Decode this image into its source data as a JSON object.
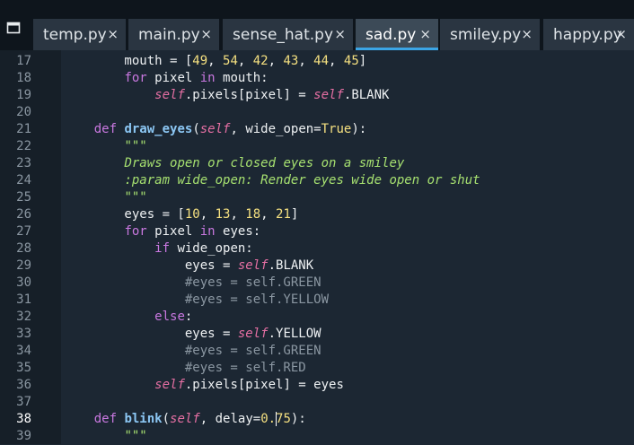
{
  "tabs": [
    {
      "label": "temp.py",
      "active": false
    },
    {
      "label": "main.py",
      "active": false
    },
    {
      "label": "sense_hat.py",
      "active": false
    },
    {
      "label": "sad.py",
      "active": true
    },
    {
      "label": "smiley.py",
      "active": false
    },
    {
      "label": "happy.py",
      "active": false
    }
  ],
  "tab_close_glyph": "×",
  "tabs_menu_icon": "tabs-menu-icon",
  "editor": {
    "current_line": 38,
    "lines": [
      {
        "n": "17",
        "tokens": [
          [
            "txt",
            "        mouth = ["
          ],
          [
            "num",
            "49"
          ],
          [
            "txt",
            ", "
          ],
          [
            "num",
            "54"
          ],
          [
            "txt",
            ", "
          ],
          [
            "num",
            "42"
          ],
          [
            "txt",
            ", "
          ],
          [
            "num",
            "43"
          ],
          [
            "txt",
            ", "
          ],
          [
            "num",
            "44"
          ],
          [
            "txt",
            ", "
          ],
          [
            "num",
            "45"
          ],
          [
            "txt",
            "]"
          ]
        ]
      },
      {
        "n": "18",
        "tokens": [
          [
            "txt",
            "        "
          ],
          [
            "kw",
            "for"
          ],
          [
            "txt",
            " pixel "
          ],
          [
            "kw",
            "in"
          ],
          [
            "txt",
            " mouth:"
          ]
        ]
      },
      {
        "n": "19",
        "tokens": [
          [
            "txt",
            "            "
          ],
          [
            "self",
            "self"
          ],
          [
            "txt",
            ".pixels[pixel] = "
          ],
          [
            "self",
            "self"
          ],
          [
            "txt",
            ".BLANK"
          ]
        ]
      },
      {
        "n": "20",
        "tokens": []
      },
      {
        "n": "21",
        "tokens": [
          [
            "txt",
            "    "
          ],
          [
            "kw",
            "def"
          ],
          [
            "txt",
            " "
          ],
          [
            "fn",
            "draw_eyes"
          ],
          [
            "txt",
            "("
          ],
          [
            "self",
            "self"
          ],
          [
            "txt",
            ", wide_open="
          ],
          [
            "num",
            "True"
          ],
          [
            "txt",
            "):"
          ]
        ]
      },
      {
        "n": "22",
        "tokens": [
          [
            "txt",
            "        "
          ],
          [
            "str",
            "\"\"\""
          ]
        ]
      },
      {
        "n": "23",
        "tokens": [
          [
            "txt",
            "        "
          ],
          [
            "str",
            "Draws open or closed eyes on a smiley"
          ]
        ]
      },
      {
        "n": "24",
        "tokens": [
          [
            "txt",
            "        "
          ],
          [
            "str",
            ":param wide_open: Render eyes wide open or shut"
          ]
        ]
      },
      {
        "n": "25",
        "tokens": [
          [
            "txt",
            "        "
          ],
          [
            "str",
            "\"\"\""
          ]
        ]
      },
      {
        "n": "26",
        "tokens": [
          [
            "txt",
            "        eyes = ["
          ],
          [
            "num",
            "10"
          ],
          [
            "txt",
            ", "
          ],
          [
            "num",
            "13"
          ],
          [
            "txt",
            ", "
          ],
          [
            "num",
            "18"
          ],
          [
            "txt",
            ", "
          ],
          [
            "num",
            "21"
          ],
          [
            "txt",
            "]"
          ]
        ]
      },
      {
        "n": "27",
        "tokens": [
          [
            "txt",
            "        "
          ],
          [
            "kw",
            "for"
          ],
          [
            "txt",
            " pixel "
          ],
          [
            "kw",
            "in"
          ],
          [
            "txt",
            " eyes:"
          ]
        ]
      },
      {
        "n": "28",
        "tokens": [
          [
            "txt",
            "            "
          ],
          [
            "kw",
            "if"
          ],
          [
            "txt",
            " wide_open:"
          ]
        ]
      },
      {
        "n": "29",
        "tokens": [
          [
            "txt",
            "                eyes = "
          ],
          [
            "self",
            "self"
          ],
          [
            "txt",
            ".BLANK"
          ]
        ]
      },
      {
        "n": "30",
        "tokens": [
          [
            "txt",
            "                "
          ],
          [
            "cmt",
            "#eyes = self.GREEN"
          ]
        ]
      },
      {
        "n": "31",
        "tokens": [
          [
            "txt",
            "                "
          ],
          [
            "cmt",
            "#eyes = self.YELLOW"
          ]
        ]
      },
      {
        "n": "32",
        "tokens": [
          [
            "txt",
            "            "
          ],
          [
            "kw",
            "else"
          ],
          [
            "txt",
            ":"
          ]
        ]
      },
      {
        "n": "33",
        "tokens": [
          [
            "txt",
            "                eyes = "
          ],
          [
            "self",
            "self"
          ],
          [
            "txt",
            ".YELLOW"
          ]
        ]
      },
      {
        "n": "34",
        "tokens": [
          [
            "txt",
            "                "
          ],
          [
            "cmt",
            "#eyes = self.GREEN"
          ]
        ]
      },
      {
        "n": "35",
        "tokens": [
          [
            "txt",
            "                "
          ],
          [
            "cmt",
            "#eyes = self.RED"
          ]
        ]
      },
      {
        "n": "36",
        "tokens": [
          [
            "txt",
            "            "
          ],
          [
            "self",
            "self"
          ],
          [
            "txt",
            ".pixels[pixel] = eyes"
          ]
        ]
      },
      {
        "n": "37",
        "tokens": []
      },
      {
        "n": "38",
        "tokens": [
          [
            "txt",
            "    "
          ],
          [
            "kw",
            "def"
          ],
          [
            "txt",
            " "
          ],
          [
            "fn",
            "blink"
          ],
          [
            "txt",
            "("
          ],
          [
            "self",
            "self"
          ],
          [
            "txt",
            ", delay="
          ],
          [
            "num",
            "0.75"
          ],
          [
            "txt",
            "):"
          ]
        ]
      },
      {
        "n": "39",
        "tokens": [
          [
            "txt",
            "        "
          ],
          [
            "str",
            "\"\"\""
          ]
        ]
      }
    ]
  },
  "colors": {
    "editor_bg": "#1c2733",
    "gutter_bg": "#161f28",
    "tabbar_bg": "#0e151c",
    "active_tab_accent": "#3ba5e5",
    "keyword": "#c978e0",
    "function": "#8cc7f4",
    "self": "#e56fa3",
    "number": "#f5e080",
    "string": "#a6e070",
    "comment": "#8a96a1"
  }
}
